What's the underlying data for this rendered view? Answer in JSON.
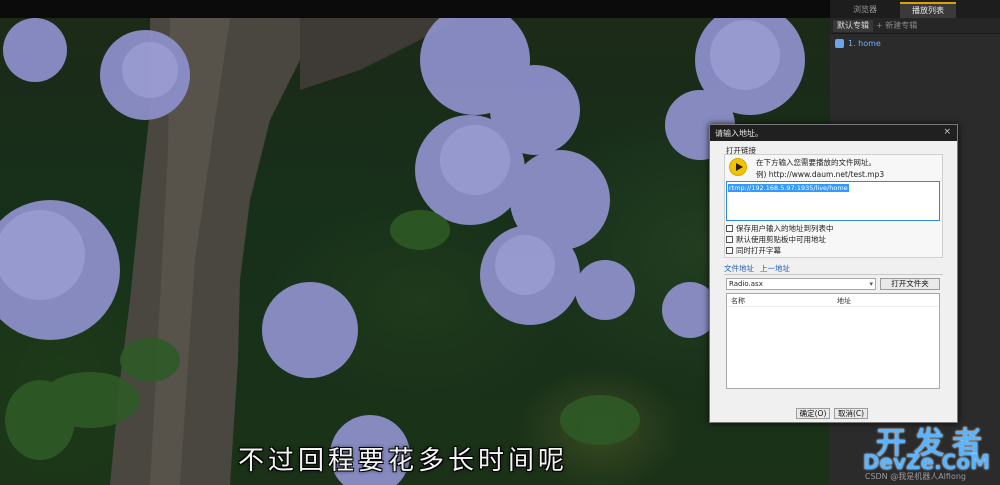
{
  "panel": {
    "tabs": [
      "浏览器",
      "播放列表"
    ],
    "subtabs": [
      "默认专辑",
      "+ 新建专辑"
    ],
    "items": [
      {
        "label": "1. home"
      }
    ]
  },
  "dialog": {
    "title": "请输入地址。",
    "close": "×",
    "group_label": "打开链接",
    "hint_line1": "在下方输入您需要播放的文件网址。",
    "hint_line2": "例) http://www.daum.net/test.mp3",
    "url_value": "rtmp://192.168.5.97:1935/live/home",
    "checkboxes": [
      "保存用户输入的地址到列表中",
      "默认使用剪贴板中可用地址",
      "同时打开字幕"
    ],
    "tabs": [
      "文件地址",
      "上一地址"
    ],
    "combo_value": "Radio.asx",
    "open_folder_label": "打开文件夹",
    "list_headers": [
      "名称",
      "地址"
    ],
    "ok_label": "确定(O)",
    "cancel_label": "取消(C)"
  },
  "subtitle": "不过回程要花多长时间呢",
  "watermark": {
    "logo": "开发者",
    "domain": "DevZe.CoM",
    "credit": "CSDN @我是机器人Alfiong"
  },
  "colors": {
    "accent": "#e0a000",
    "link": "#2161b6",
    "selection": "#3399ff",
    "play_icon": "#f2c400",
    "watermark": "#5ab4ff"
  }
}
